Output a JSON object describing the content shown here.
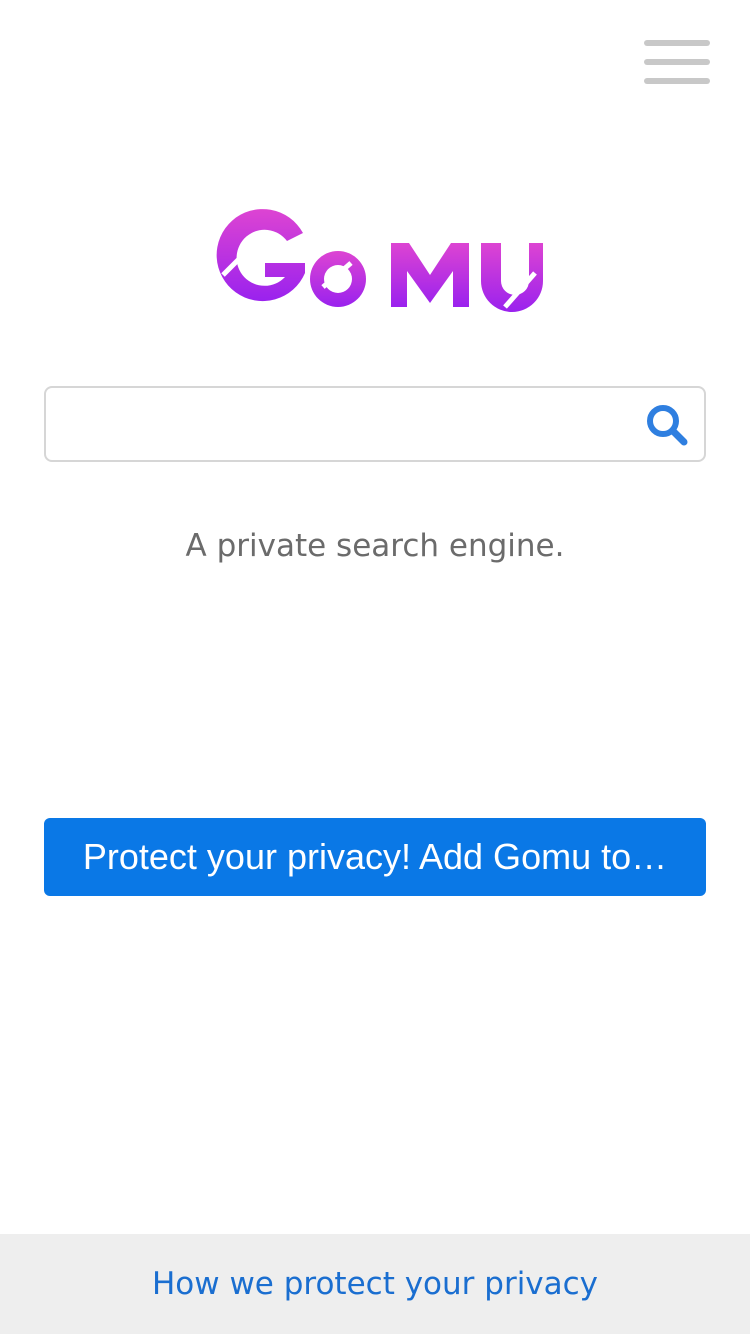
{
  "header": {
    "menu_icon": "hamburger-menu-icon",
    "menu_color": "#c8c8c8"
  },
  "logo": {
    "text": "GOMU",
    "gradient_start": "#dd44d2",
    "gradient_end": "#9a22ee"
  },
  "search": {
    "value": "",
    "placeholder": "",
    "icon": "search-icon",
    "icon_color": "#2f7fe0"
  },
  "tagline": "A private search engine.",
  "cta": {
    "label": "Protect your privacy! Add Gomu to…",
    "color": "#0a78e6"
  },
  "footer": {
    "link_label": "How we protect your privacy",
    "link_color": "#1a6ed0"
  }
}
